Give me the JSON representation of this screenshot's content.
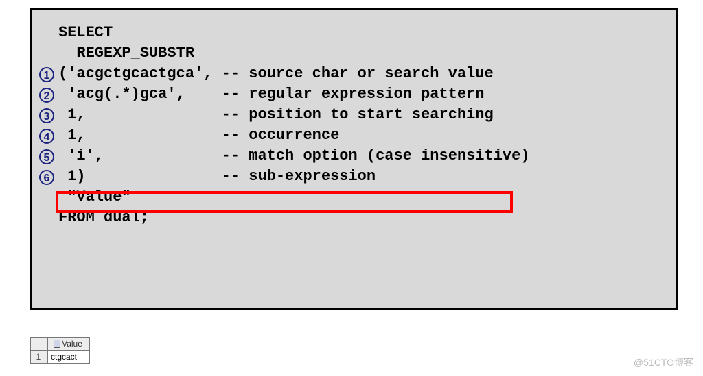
{
  "code": {
    "line1": "SELECT",
    "line2": "  REGEXP_SUBSTR",
    "line3": "('acgctgcactgca', -- source char or search value",
    "line4": " 'acg(.*)gca',    -- regular expression pattern",
    "line5": " 1,               -- position to start searching",
    "line6": " 1,               -- occurrence",
    "line7": " 'i',             -- match option (case insensitive)",
    "line8": " 1)               -- sub-expression",
    "line9": " \"Value\"",
    "line10": "FROM dual;"
  },
  "markers": {
    "m1": "1",
    "m2": "2",
    "m3": "3",
    "m4": "4",
    "m5": "5",
    "m6": "6"
  },
  "result": {
    "column": "Value",
    "rownum": "1",
    "cell": "ctgcact"
  },
  "watermark": "@51CTO博客"
}
